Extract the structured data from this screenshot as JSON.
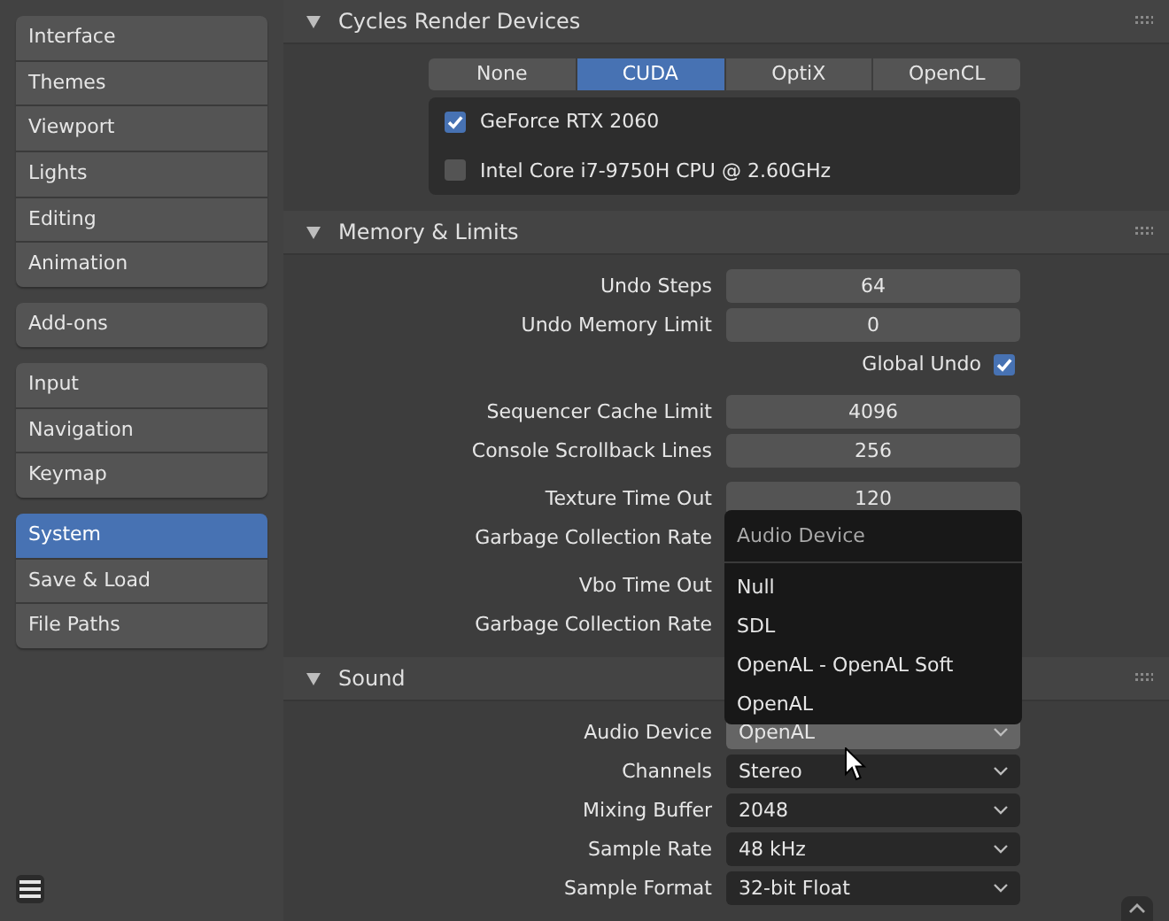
{
  "sidebar": {
    "groups": [
      [
        {
          "label": "Interface",
          "selected": false
        },
        {
          "label": "Themes",
          "selected": false
        },
        {
          "label": "Viewport",
          "selected": false
        },
        {
          "label": "Lights",
          "selected": false
        },
        {
          "label": "Editing",
          "selected": false
        },
        {
          "label": "Animation",
          "selected": false
        }
      ],
      [
        {
          "label": "Add-ons",
          "selected": false
        }
      ],
      [
        {
          "label": "Input",
          "selected": false
        },
        {
          "label": "Navigation",
          "selected": false
        },
        {
          "label": "Keymap",
          "selected": false
        }
      ],
      [
        {
          "label": "System",
          "selected": true
        },
        {
          "label": "Save & Load",
          "selected": false
        },
        {
          "label": "File Paths",
          "selected": false
        }
      ]
    ]
  },
  "sections": [
    {
      "title": "Cycles Render Devices",
      "expanded": true,
      "kind": "devices",
      "backends": [
        {
          "label": "None",
          "selected": false
        },
        {
          "label": "CUDA",
          "selected": true
        },
        {
          "label": "OptiX",
          "selected": false
        },
        {
          "label": "OpenCL",
          "selected": false
        }
      ],
      "devices": [
        {
          "name": "GeForce RTX 2060",
          "checked": true
        },
        {
          "name": "Intel Core i7-9750H CPU @ 2.60GHz",
          "checked": false
        }
      ]
    },
    {
      "title": "Memory & Limits",
      "expanded": true,
      "kind": "properties",
      "groups": [
        [
          {
            "kind": "number",
            "label": "Undo Steps",
            "value": "64"
          },
          {
            "kind": "number",
            "label": "Undo Memory Limit",
            "value": "0"
          },
          {
            "kind": "checkbox",
            "label": "Global Undo",
            "checked": true
          }
        ],
        [
          {
            "kind": "number",
            "label": "Sequencer Cache Limit",
            "value": "4096"
          },
          {
            "kind": "number",
            "label": "Console Scrollback Lines",
            "value": "256"
          }
        ],
        [
          {
            "kind": "number",
            "label": "Texture Time Out",
            "value": "120"
          },
          {
            "kind": "number",
            "label": "Garbage Collection Rate"
          }
        ],
        [
          {
            "kind": "number",
            "label": "Vbo Time Out"
          },
          {
            "kind": "number",
            "label": "Garbage Collection Rate"
          }
        ]
      ]
    },
    {
      "title": "Sound",
      "expanded": true,
      "kind": "properties",
      "groups": [
        [
          {
            "kind": "dropdown",
            "label": "Audio Device",
            "value": "OpenAL",
            "hovered": true
          },
          {
            "kind": "dropdown",
            "label": "Channels",
            "value": "Stereo",
            "hovered": false
          },
          {
            "kind": "dropdown",
            "label": "Mixing Buffer",
            "value": "2048",
            "hovered": false
          },
          {
            "kind": "dropdown",
            "label": "Sample Rate",
            "value": "48 kHz",
            "hovered": false
          },
          {
            "kind": "dropdown",
            "label": "Sample Format",
            "value": "32-bit Float",
            "hovered": false
          }
        ]
      ]
    }
  ],
  "popup": {
    "title": "Audio Device",
    "items": [
      "Null",
      "SDL",
      "OpenAL - OpenAL Soft",
      "OpenAL"
    ]
  }
}
